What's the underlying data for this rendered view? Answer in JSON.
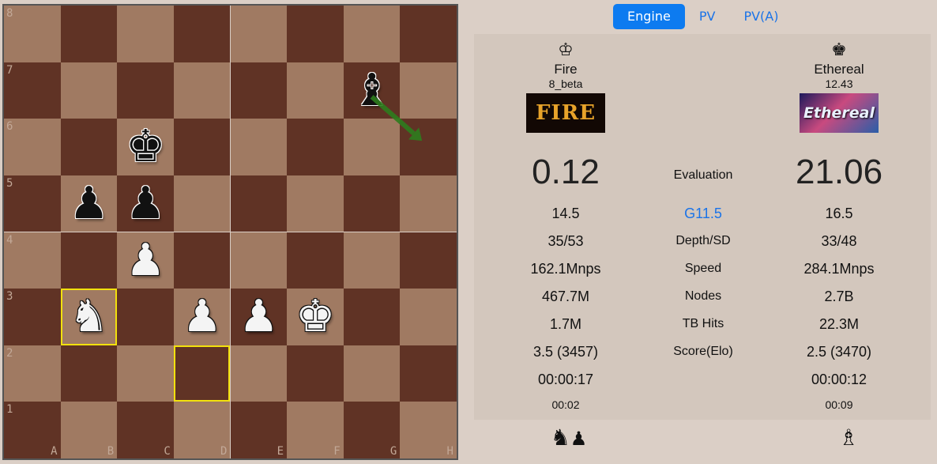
{
  "board": {
    "files": [
      "A",
      "B",
      "C",
      "D",
      "E",
      "F",
      "G",
      "H"
    ],
    "ranks": [
      "8",
      "7",
      "6",
      "5",
      "4",
      "3",
      "2",
      "1"
    ],
    "pieces": [
      {
        "square": "g7",
        "symbol": "♝",
        "color": "b",
        "name": "black-bishop"
      },
      {
        "square": "c6",
        "symbol": "♚",
        "color": "b",
        "name": "black-king"
      },
      {
        "square": "b5",
        "symbol": "♟",
        "color": "b",
        "name": "black-pawn"
      },
      {
        "square": "c5",
        "symbol": "♟",
        "color": "b",
        "name": "black-pawn"
      },
      {
        "square": "c4",
        "symbol": "♟",
        "color": "w",
        "name": "white-pawn"
      },
      {
        "square": "b3",
        "symbol": "♞",
        "color": "w",
        "name": "white-knight"
      },
      {
        "square": "d3",
        "symbol": "♟",
        "color": "w",
        "name": "white-pawn"
      },
      {
        "square": "e3",
        "symbol": "♟",
        "color": "w",
        "name": "white-pawn"
      },
      {
        "square": "f3",
        "symbol": "♚",
        "color": "w",
        "name": "white-king"
      }
    ],
    "highlighted": [
      "b3",
      "d2"
    ],
    "arrow": {
      "from": "g7",
      "to": "h6",
      "color": "#2e7d1e"
    }
  },
  "tabs": [
    {
      "label": "Engine",
      "active": true
    },
    {
      "label": "PV",
      "active": false
    },
    {
      "label": "PV(A)",
      "active": false
    }
  ],
  "white": {
    "icon": "♔",
    "name": "Fire",
    "version": "8_beta",
    "logo_text": "FIRE",
    "eval": "0.12",
    "moves": "14.5",
    "depth": "35/53",
    "speed": "162.1Mnps",
    "nodes": "467.7M",
    "tbhits": "1.7M",
    "score": "3.5 (3457)",
    "time": "00:00:17",
    "movetime": "00:02",
    "captured": [
      "♞",
      "♟"
    ]
  },
  "black": {
    "icon": "♚",
    "name": "Ethereal",
    "version": "12.43",
    "logo_text": "Ethereal",
    "eval": "21.06",
    "moves": "16.5",
    "depth": "33/48",
    "speed": "284.1Mnps",
    "nodes": "2.7B",
    "tbhits": "22.3M",
    "score": "2.5 (3470)",
    "time": "00:00:12",
    "movetime": "00:09",
    "captured": [
      "♗"
    ]
  },
  "labels": {
    "eval": "Evaluation",
    "game": "G11.5",
    "depth": "Depth/SD",
    "speed": "Speed",
    "nodes": "Nodes",
    "tbhits": "TB Hits",
    "score": "Score(Elo)"
  },
  "colors": {
    "accent": "#0d7bf0",
    "link": "#1a73e8",
    "light_square": "#a07a62",
    "dark_square": "#603325",
    "highlight": "#f2e10d"
  }
}
